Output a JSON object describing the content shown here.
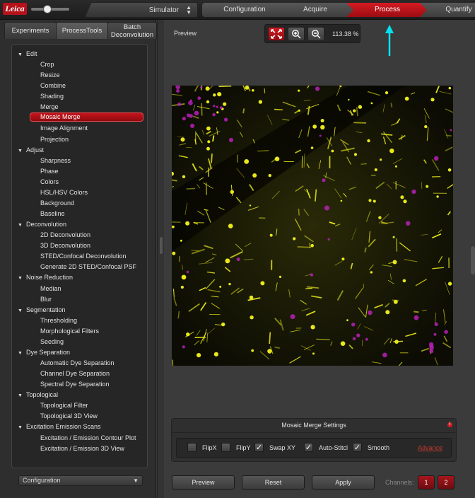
{
  "app": {
    "logo_text": "Leica",
    "machine": "Simulator",
    "workflow_steps": [
      "Configuration",
      "Acquire",
      "Process",
      "Quantify"
    ],
    "active_step": "Process"
  },
  "left_panel": {
    "tabs": [
      "Experiments",
      "ProcessTools",
      "Batch Deconvolution"
    ],
    "tab_batch_line1": "Batch",
    "tab_batch_line2": "Deconvolution",
    "active_tab": "ProcessTools",
    "tree": [
      {
        "group": "Edit",
        "items": [
          "Crop",
          "Resize",
          "Combine",
          "Shading",
          "Merge",
          "Mosaic Merge",
          "Image Alignment",
          "Projection"
        ]
      },
      {
        "group": "Adjust",
        "items": [
          "Sharpness",
          "Phase",
          "Colors",
          "HSL/HSV Colors",
          "Background",
          "Baseline"
        ]
      },
      {
        "group": "Deconvolution",
        "items": [
          "2D Deconvolution",
          "3D Deconvolution",
          "STED/Confocal Deconvolution",
          "Generate 2D STED/Confocal PSF"
        ]
      },
      {
        "group": "Noise Reduction",
        "items": [
          "Median",
          "Blur"
        ]
      },
      {
        "group": "Segmentation",
        "items": [
          "Thresholding",
          "Morphological Filters",
          "Seeding"
        ]
      },
      {
        "group": "Dye Separation",
        "items": [
          "Automatic Dye Separation",
          "Channel Dye Separation",
          "Spectral Dye Separation"
        ]
      },
      {
        "group": "Topological",
        "items": [
          "Topological Filter",
          "Topological 3D View"
        ]
      },
      {
        "group": "Excitation Emission Scans",
        "items": [
          "Excitation / Emission Contour Plot",
          "Excitation / Emission 3D View"
        ]
      }
    ],
    "selected_item": "Mosaic Merge",
    "configuration_select": "Configuration"
  },
  "preview": {
    "label": "Preview",
    "zoom": "113.38 %"
  },
  "settings": {
    "title": "Mosaic Merge Settings",
    "info_badge": "i",
    "options": [
      {
        "label": "FlipX",
        "checked": false
      },
      {
        "label": "FlipY",
        "checked": false
      },
      {
        "label": "Swap XY",
        "checked": true
      },
      {
        "label": "Auto-Stitcl",
        "checked": true
      },
      {
        "label": "Smooth",
        "checked": true
      }
    ],
    "advance_link": "Advance"
  },
  "buttons": {
    "preview": "Preview",
    "reset": "Reset",
    "apply": "Apply"
  },
  "channels": {
    "label": "Channels:",
    "items": [
      "1",
      "2"
    ]
  },
  "colors": {
    "accent_red": "#c8141c",
    "annotation_arrow": "#00e5f0",
    "fluorescence_yellow": "#e8e81c",
    "fluorescence_magenta": "#c020c0"
  }
}
